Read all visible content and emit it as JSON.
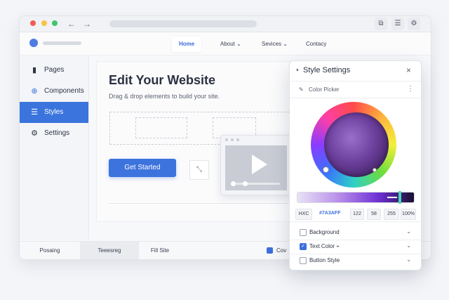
{
  "nav": {
    "home": "Home",
    "about": "About ⌄",
    "services": "Sevices ⌄",
    "contact": "Contacy"
  },
  "sidebar": {
    "items": [
      {
        "label": "Pages",
        "icon": "pages-icon",
        "glyph": "▮"
      },
      {
        "label": "Components",
        "icon": "components-icon",
        "glyph": "⊕"
      },
      {
        "label": "Styles",
        "icon": "styles-icon",
        "glyph": "☰"
      },
      {
        "label": "Settings",
        "icon": "gear-icon",
        "glyph": "⚙"
      }
    ],
    "active_index": 2
  },
  "canvas": {
    "title": "Edit Your Website",
    "subtitle": "Drag & drop elements to build your site.",
    "cta_label": "Get Started"
  },
  "bottom_bar": {
    "tabs": [
      "Posaing",
      "Teeesreg",
      "Fill Site"
    ],
    "cov_label": "Cov"
  },
  "style_panel": {
    "title": "Style Settings",
    "close_glyph": "×",
    "color_picker_label": "Color Picker",
    "selected_color": "#7A3AFF",
    "hex_label": "HXC",
    "hex_value": "#7A3AFF",
    "r": "122",
    "g": "58",
    "b": "255",
    "alpha": "100%",
    "properties": [
      {
        "label": "Background",
        "checked": false
      },
      {
        "label": "Text Color ⌁",
        "checked": true
      },
      {
        "label": "Button Style",
        "checked": false
      }
    ]
  },
  "colors": {
    "accent": "#3B74DC",
    "primary_button": "#3D73DD",
    "traffic_red": "#F25C54",
    "traffic_yellow": "#F6C344",
    "traffic_green": "#3FC56B"
  }
}
